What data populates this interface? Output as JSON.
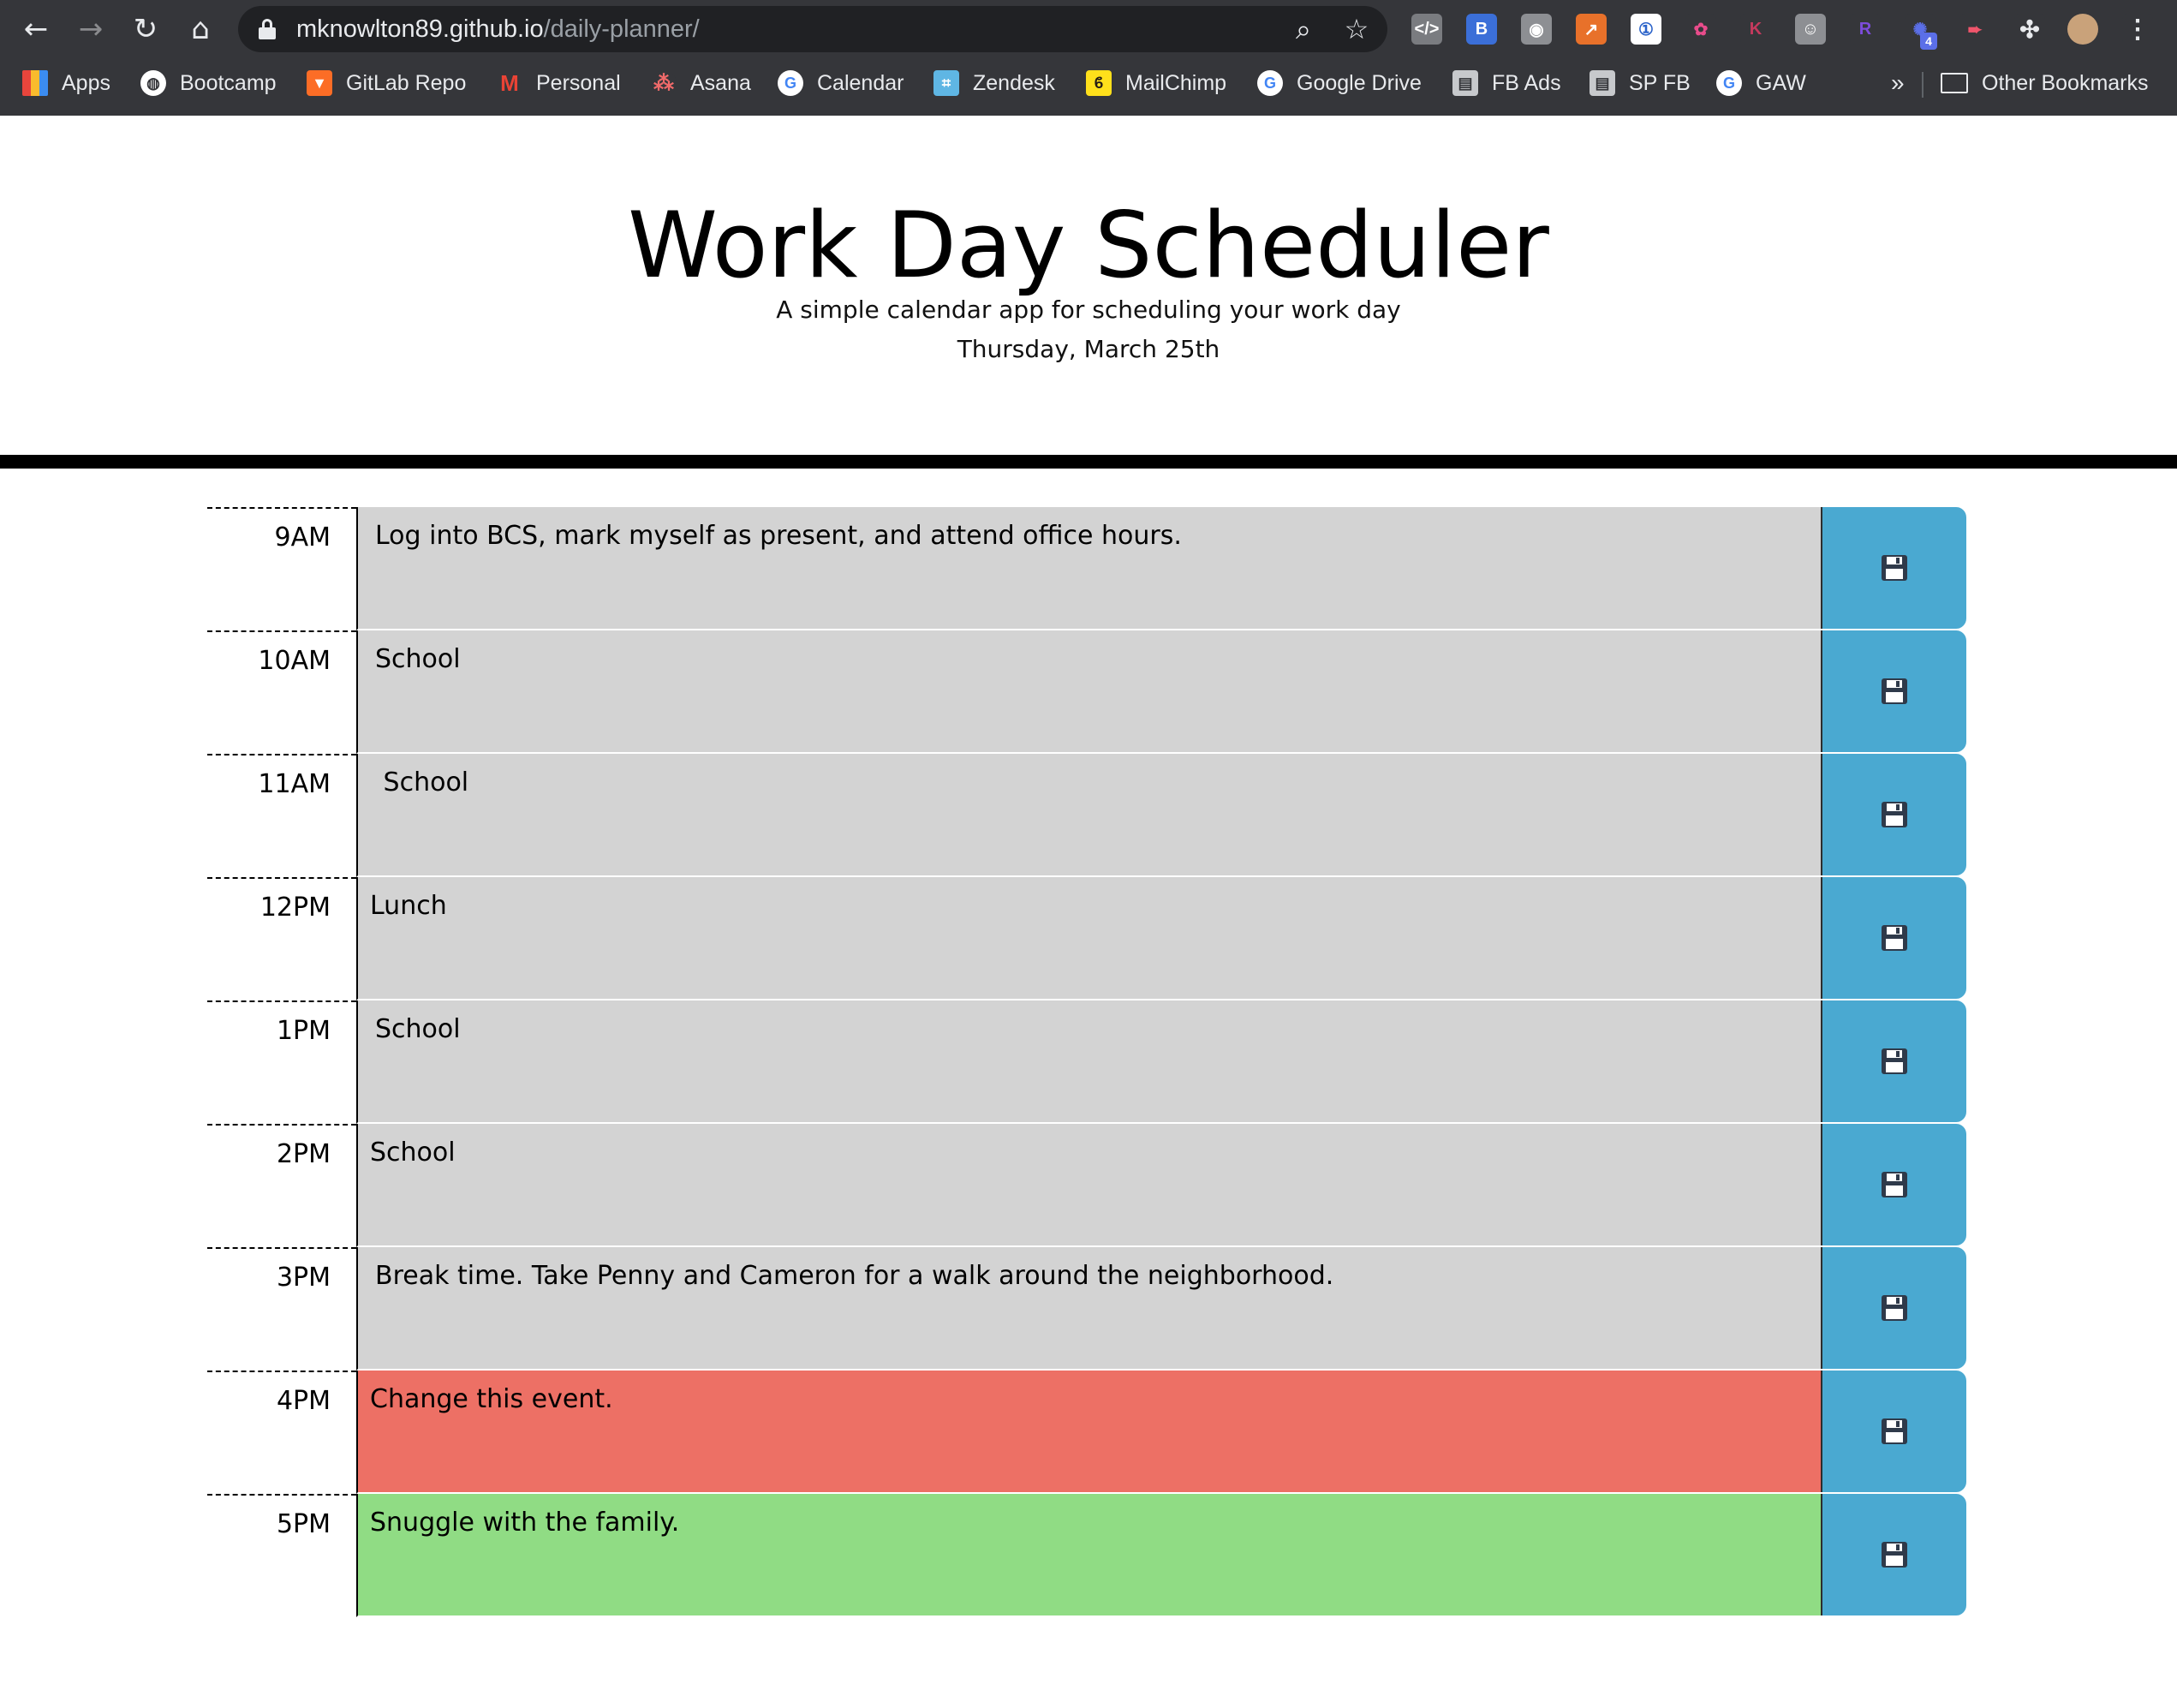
{
  "browser": {
    "url_host": "mknowlton89.github.io",
    "url_path": "/daily-planner/",
    "bookmarks": [
      {
        "label": "Apps",
        "icon": "apps-grid-icon",
        "color": "#e8453c"
      },
      {
        "label": "Bootcamp",
        "icon": "globe-icon",
        "color": "#ffffff"
      },
      {
        "label": "GitLab Repo",
        "icon": "gitlab-icon",
        "color": "#fc6d26"
      },
      {
        "label": "Personal",
        "icon": "gmail-icon",
        "color": "#ea4335"
      },
      {
        "label": "Asana",
        "icon": "asana-icon",
        "color": "#f06a6a"
      },
      {
        "label": "Calendar",
        "icon": "google-icon",
        "color": "#ffffff"
      },
      {
        "label": "Zendesk",
        "icon": "zendesk-icon",
        "color": "#5fb6e4"
      },
      {
        "label": "MailChimp",
        "icon": "mailchimp-icon",
        "color": "#ffe01b"
      },
      {
        "label": "Google Drive",
        "icon": "google-icon",
        "color": "#ffffff"
      },
      {
        "label": "FB Ads",
        "icon": "document-icon",
        "color": "#c7c9cc"
      },
      {
        "label": "SP FB",
        "icon": "document-icon",
        "color": "#c7c9cc"
      },
      {
        "label": "GAW",
        "icon": "google-icon",
        "color": "#ffffff"
      }
    ],
    "overflow_label": "»",
    "other_bookmarks_label": "Other Bookmarks",
    "extension_badge": "4"
  },
  "header": {
    "title": "Work Day Scheduler",
    "subtitle": "A simple calendar app for scheduling your work day",
    "date": "Thursday, March 25th"
  },
  "colors": {
    "past": "#d3d3d3",
    "present": "#ed7065",
    "future": "#90dc84",
    "save_button": "#4aa9d1"
  },
  "schedule": [
    {
      "hour": "9AM",
      "text": "Log into BCS, mark myself as present, and attend office hours.",
      "state": "past"
    },
    {
      "hour": "10AM",
      "text": "School",
      "state": "past"
    },
    {
      "hour": "11AM",
      "text": " School",
      "state": "past"
    },
    {
      "hour": "12PM",
      "text": "Lunch",
      "state": "past"
    },
    {
      "hour": "1PM",
      "text": "School",
      "state": "past"
    },
    {
      "hour": "2PM",
      "text": "School",
      "state": "past"
    },
    {
      "hour": "3PM",
      "text": "Break time. Take Penny and Cameron for a walk around the neighborhood.",
      "state": "past"
    },
    {
      "hour": "4PM",
      "text": "Change this event.",
      "state": "present"
    },
    {
      "hour": "5PM",
      "text": "Snuggle with the family.",
      "state": "future"
    }
  ],
  "save_icon": "floppy-disk-icon"
}
